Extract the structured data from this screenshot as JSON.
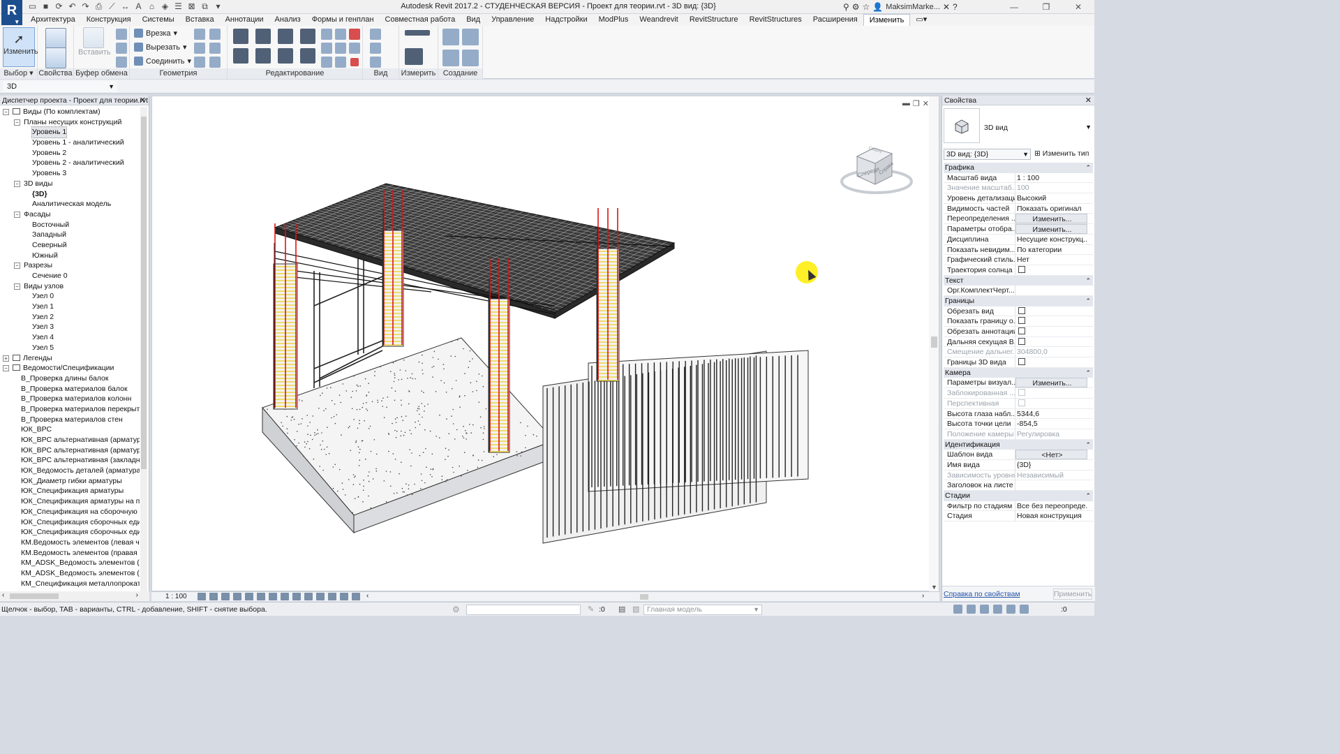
{
  "window": {
    "title": "Autodesk Revit 2017.2 - СТУДЕНЧЕСКАЯ ВЕРСИЯ -    Проект для теории.rvt - 3D вид: {3D}",
    "user": "MaksimMarke...",
    "app_letter": "R"
  },
  "ribbon": {
    "tabs": [
      "Архитектура",
      "Конструкция",
      "Системы",
      "Вставка",
      "Аннотации",
      "Анализ",
      "Формы и генплан",
      "Совместная работа",
      "Вид",
      "Управление",
      "Надстройки",
      "ModPlus",
      "Weandrevit",
      "RevitStructure",
      "RevitStructures",
      "Расширения",
      "Изменить"
    ],
    "active_tab": "Изменить",
    "modify_label": "Изменить",
    "paste_label": "Вставить",
    "cope_label": "Врезка",
    "cut_label": "Вырезать",
    "join_label": "Соединить",
    "groups": {
      "select": "Выбор",
      "properties": "Свойства",
      "clipboard": "Буфер обмена",
      "geometry": "Геометрия",
      "modify": "Редактирование",
      "view": "Вид",
      "measure": "Измерить",
      "create": "Создание"
    }
  },
  "typebar": {
    "value": "3D"
  },
  "browser": {
    "title": "Диспетчер проекта - Проект для теории.rvt",
    "items": [
      {
        "label": "Виды (По комплектам)",
        "level": 0,
        "toggle": "−",
        "icon": "views"
      },
      {
        "label": "Планы несущих конструкций",
        "level": 1,
        "toggle": "−"
      },
      {
        "label": "Уровень 1",
        "level": 2,
        "selected": true
      },
      {
        "label": "Уровень 1 - аналитический",
        "level": 2
      },
      {
        "label": "Уровень 2",
        "level": 2
      },
      {
        "label": "Уровень 2 - аналитический",
        "level": 2
      },
      {
        "label": "Уровень 3",
        "level": 2
      },
      {
        "label": "3D виды",
        "level": 1,
        "toggle": "−"
      },
      {
        "label": "{3D}",
        "level": 2,
        "bold": true
      },
      {
        "label": "Аналитическая модель",
        "level": 2
      },
      {
        "label": "Фасады",
        "level": 1,
        "toggle": "−"
      },
      {
        "label": "Восточный",
        "level": 2
      },
      {
        "label": "Западный",
        "level": 2
      },
      {
        "label": "Северный",
        "level": 2
      },
      {
        "label": "Южный",
        "level": 2
      },
      {
        "label": "Разрезы",
        "level": 1,
        "toggle": "−"
      },
      {
        "label": "Сечение 0",
        "level": 2
      },
      {
        "label": "Виды узлов",
        "level": 1,
        "toggle": "−"
      },
      {
        "label": "Узел 0",
        "level": 2
      },
      {
        "label": "Узел 1",
        "level": 2
      },
      {
        "label": "Узел 2",
        "level": 2
      },
      {
        "label": "Узел 3",
        "level": 2
      },
      {
        "label": "Узел 4",
        "level": 2
      },
      {
        "label": "Узел 5",
        "level": 2
      },
      {
        "label": "Легенды",
        "level": 0,
        "toggle": "+",
        "icon": "table"
      },
      {
        "label": "Ведомости/Спецификации",
        "level": 0,
        "toggle": "−",
        "icon": "table"
      },
      {
        "label": "В_Проверка длины балок",
        "level": 1
      },
      {
        "label": "В_Проверка материалов балок",
        "level": 1
      },
      {
        "label": "В_Проверка материалов колонн",
        "level": 1
      },
      {
        "label": "В_Проверка материалов перекрыти",
        "level": 1
      },
      {
        "label": "В_Проверка материалов стен",
        "level": 1
      },
      {
        "label": "ЮК_ВРС",
        "level": 1
      },
      {
        "label": "ЮК_ВРС альтернативная (арматура",
        "level": 1
      },
      {
        "label": "ЮК_ВРС альтернативная (арматура,",
        "level": 1
      },
      {
        "label": "ЮК_ВРС альтернативная (закладные",
        "level": 1
      },
      {
        "label": "ЮК_Ведомость деталей (арматура)",
        "level": 1
      },
      {
        "label": "ЮК_Диаметр гибки арматуры",
        "level": 1
      },
      {
        "label": "ЮК_Спецификация арматуры",
        "level": 1
      },
      {
        "label": "ЮК_Спецификация арматуры на пе",
        "level": 1
      },
      {
        "label": "ЮК_Спецификация на сборочную е",
        "level": 1
      },
      {
        "label": "ЮК_Спецификация сборочных еди",
        "level": 1
      },
      {
        "label": "ЮК_Спецификация сборочных еди",
        "level": 1
      },
      {
        "label": "КМ.Ведомость элементов (левая ча",
        "level": 1
      },
      {
        "label": "КМ.Ведомость элементов (правая ч",
        "level": 1
      },
      {
        "label": "КМ_ADSK_Ведомость элементов (ле",
        "level": 1
      },
      {
        "label": "КМ_ADSK_Ведомость элементов (пр",
        "level": 1
      },
      {
        "label": "КМ_Спецификация металлопроката",
        "level": 1
      }
    ]
  },
  "viewport": {
    "scale": "1 : 100",
    "viewcube_front": "Спереди",
    "viewcube_right": "Справа",
    "viewcube_top": "Сверху"
  },
  "properties": {
    "title": "Свойства",
    "type_name": "3D вид",
    "instance": "3D вид: {3D}",
    "edit_type": "Изменить тип",
    "sections": [
      {
        "name": "Графика",
        "rows": [
          {
            "k": "Масштаб вида",
            "v": "1 : 100"
          },
          {
            "k": "Значение масштаб...",
            "v": "100",
            "gray": true
          },
          {
            "k": "Уровень детализации",
            "v": "Высокий"
          },
          {
            "k": "Видимость частей",
            "v": "Показать оригинал"
          },
          {
            "k": "Переопределения ...",
            "v": "Изменить...",
            "btn": true
          },
          {
            "k": "Параметры отобра...",
            "v": "Изменить...",
            "btn": true
          },
          {
            "k": "Дисциплина",
            "v": "Несущие конструкц..."
          },
          {
            "k": "Показать невидим...",
            "v": "По категории"
          },
          {
            "k": "Графический стиль...",
            "v": "Нет"
          },
          {
            "k": "Траектория солнца",
            "v": "",
            "cb": true
          }
        ]
      },
      {
        "name": "Текст",
        "rows": [
          {
            "k": "Орг.КомплектЧерт...",
            "v": ""
          }
        ]
      },
      {
        "name": "Границы",
        "rows": [
          {
            "k": "Обрезать вид",
            "v": "",
            "cb": true
          },
          {
            "k": "Показать границу о...",
            "v": "",
            "cb": true
          },
          {
            "k": "Обрезать аннотации",
            "v": "",
            "cb": true
          },
          {
            "k": "Дальняя секущая В...",
            "v": "",
            "cb": true
          },
          {
            "k": "Смещение дальнег...",
            "v": "304800,0",
            "gray": true
          },
          {
            "k": "Границы 3D вида",
            "v": "",
            "cb": true
          }
        ]
      },
      {
        "name": "Камера",
        "rows": [
          {
            "k": "Параметры визуал...",
            "v": "Изменить...",
            "btn": true
          },
          {
            "k": "Заблокированная ...",
            "v": "",
            "cb": true,
            "gray": true
          },
          {
            "k": "Перспективная",
            "v": "",
            "cb": true,
            "gray": true
          },
          {
            "k": "Высота глаза набл...",
            "v": "5344,6"
          },
          {
            "k": "Высота точки цели",
            "v": "-854,5"
          },
          {
            "k": "Положение камеры",
            "v": "Регулировка",
            "gray": true
          }
        ]
      },
      {
        "name": "Идентификация",
        "rows": [
          {
            "k": "Шаблон вида",
            "v": "<Нет>",
            "btn": true
          },
          {
            "k": "Имя вида",
            "v": "{3D}"
          },
          {
            "k": "Зависимость уровня",
            "v": "Независимый",
            "gray": true
          },
          {
            "k": "Заголовок на листе",
            "v": ""
          }
        ]
      },
      {
        "name": "Стадии",
        "rows": [
          {
            "k": "Фильтр по стадиям",
            "v": "Все без переопреде..."
          },
          {
            "k": "Стадия",
            "v": "Новая конструкция"
          }
        ]
      }
    ],
    "help_link": "Справка по свойствам",
    "apply": "Применить"
  },
  "statusbar": {
    "hint": "Щелчок - выбор, TAB - варианты, CTRL - добавление, SHIFT - снятие выбора.",
    "sel_count": ":0",
    "main_model": "Главная модель",
    "filter_count": ":0"
  },
  "colors": {
    "ribbon_bg": "#f7f7f7",
    "rebar_red": "#e01010",
    "stirrup_yellow": "#f0d020",
    "cursor_highlight": "#ffec00"
  }
}
